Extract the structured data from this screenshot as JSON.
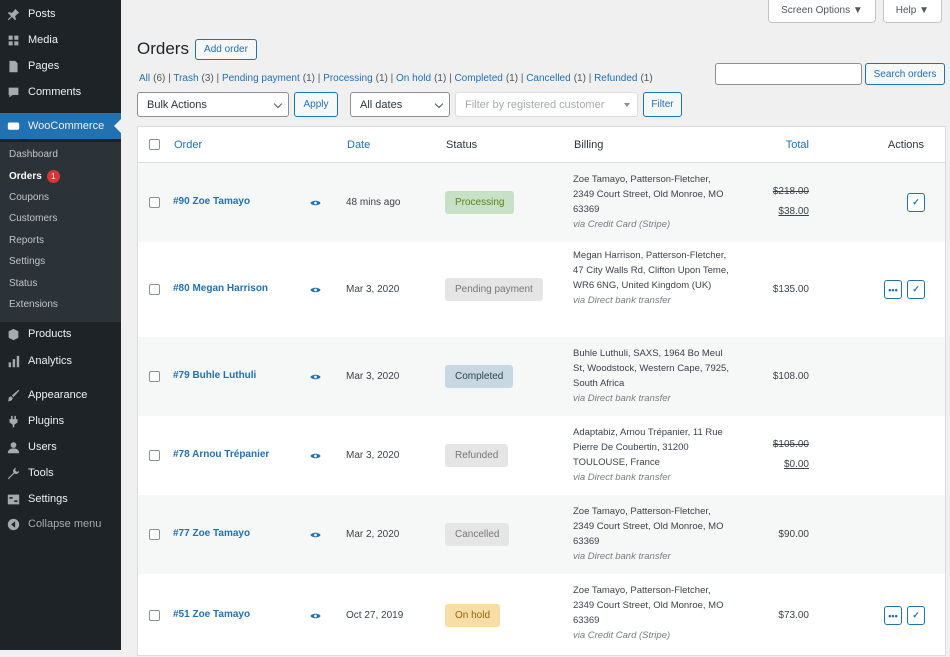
{
  "sidebar": {
    "top_items": [
      {
        "label": "Posts",
        "icon": "pin-icon"
      },
      {
        "label": "Media",
        "icon": "media-icon"
      },
      {
        "label": "Pages",
        "icon": "pages-icon"
      },
      {
        "label": "Comments",
        "icon": "comments-icon"
      }
    ],
    "woocommerce": "WooCommerce",
    "sub_items": [
      "Dashboard",
      "Orders",
      "Coupons",
      "Customers",
      "Reports",
      "Settings",
      "Status",
      "Extensions"
    ],
    "orders_badge": "1",
    "lower_items": [
      {
        "label": "Products"
      },
      {
        "label": "Analytics"
      },
      {
        "label": "Appearance"
      },
      {
        "label": "Plugins"
      },
      {
        "label": "Users"
      },
      {
        "label": "Tools"
      },
      {
        "label": "Settings"
      },
      {
        "label": "Collapse menu"
      }
    ]
  },
  "top": {
    "screen_options": "Screen Options ▼",
    "help": "Help ▼"
  },
  "page": {
    "title": "Orders",
    "add_order": "Add order"
  },
  "subsub": [
    {
      "label": "All",
      "count": "(6)"
    },
    {
      "label": "Trash",
      "count": "(3)"
    },
    {
      "label": "Pending payment",
      "count": "(1)"
    },
    {
      "label": "Processing",
      "count": "(1)"
    },
    {
      "label": "On hold",
      "count": "(1)"
    },
    {
      "label": "Completed",
      "count": "(1)"
    },
    {
      "label": "Cancelled",
      "count": "(1)"
    },
    {
      "label": "Refunded",
      "count": "(1)"
    }
  ],
  "filters": {
    "bulk_actions": "Bulk Actions",
    "apply": "Apply",
    "all_dates": "All dates",
    "customer_placeholder": "Filter by registered customer",
    "filter": "Filter",
    "search_button": "Search orders"
  },
  "columns": {
    "order": "Order",
    "date": "Date",
    "status": "Status",
    "billing": "Billing",
    "total": "Total",
    "actions": "Actions"
  },
  "rows": [
    {
      "order": "#90 Zoe Tamayo",
      "date": "48 mins ago",
      "status": "Processing",
      "billing": "Zoe Tamayo, Patterson-Fletcher, 2349 Court Street, Old Monroe, MO 63369",
      "via": "via Credit Card (Stripe)",
      "total_old": "$218.00",
      "total": "$38.00"
    },
    {
      "order": "#80 Megan Harrison",
      "date": "Mar 3, 2020",
      "status": "Pending payment",
      "billing": "Megan Harrison, Patterson-Fletcher, 47 City Walls Rd, Clifton Upon Teme, WR6 6NG, United Kingdom (UK)",
      "via": "via Direct bank transfer",
      "total": "$135.00"
    },
    {
      "order": "#79 Buhle Luthuli",
      "date": "Mar 3, 2020",
      "status": "Completed",
      "billing": "Buhle Luthuli, SAXS, 1964 Bo Meul St, Woodstock, Western Cape, 7925, South Africa",
      "via": "via Direct bank transfer",
      "total": "$108.00"
    },
    {
      "order": "#78 Arnou Trépanier",
      "date": "Mar 3, 2020",
      "status": "Refunded",
      "billing": "Adaptabiz, Arnou Trépanier, 11 Rue Pierre De Coubertin, 31200 TOULOUSE, France",
      "via": "via Direct bank transfer",
      "total_old": "$105.00",
      "total": "$0.00"
    },
    {
      "order": "#77 Zoe Tamayo",
      "date": "Mar 2, 2020",
      "status": "Cancelled",
      "billing": "Zoe Tamayo, Patterson-Fletcher, 2349 Court Street, Old Monroe, MO 63369",
      "via": "via Direct bank transfer",
      "total": "$90.00"
    },
    {
      "order": "#51 Zoe Tamayo",
      "date": "Oct 27, 2019",
      "status": "On hold",
      "billing": "Zoe Tamayo, Patterson-Fletcher, 2349 Court Street, Old Monroe, MO 63369",
      "via": "via Credit Card (Stripe)",
      "total": "$73.00"
    }
  ],
  "colors": {
    "Processing": [
      "#c6e1c6",
      "#5b841b"
    ],
    "Pending payment": [
      "#e5e5e5",
      "#777777"
    ],
    "Completed": [
      "#c8d7e1",
      "#2e4453"
    ],
    "Refunded": [
      "#e5e5e5",
      "#777777"
    ],
    "Cancelled": [
      "#e5e5e5",
      "#777777"
    ],
    "On hold": [
      "#f8dda7",
      "#94660c"
    ]
  }
}
